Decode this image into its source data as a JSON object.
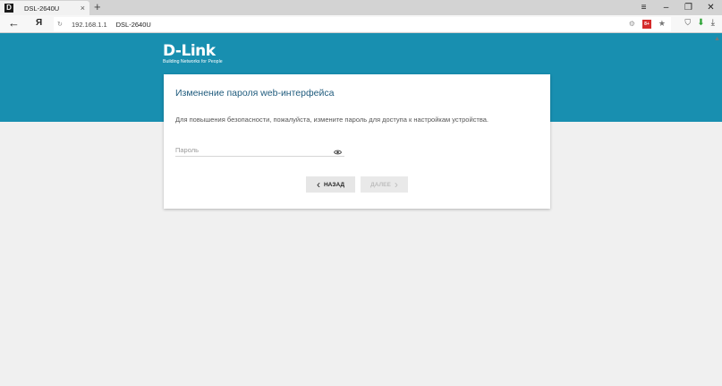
{
  "browser": {
    "tab": {
      "favicon": "D",
      "title": "DSL-2640U",
      "close_glyph": "×"
    },
    "new_tab_glyph": "+",
    "window_controls": [
      "≡",
      "–",
      "❐",
      "✕"
    ],
    "back_glyph": "←",
    "yandex_glyph": "Я",
    "reload_glyph": "↻",
    "url": "192.168.1.1",
    "page_title": "DSL-2640U",
    "badge_text": "8+",
    "star_glyph": "★",
    "shield_glyph": "⛉",
    "download_green_glyph": "⬇",
    "download_glyph": "⤓"
  },
  "logo": {
    "main": "D-Link",
    "tagline": "Building Networks for People"
  },
  "card": {
    "title": "Изменение пароля web-интерфейса",
    "description": "Для повышения безопасности, пожалуйста, измените пароль для доступа к настройкам устройства.",
    "password": {
      "placeholder": "Пароль",
      "value": ""
    },
    "back_label": "НАЗАД",
    "next_label": "ДАЛЕЕ"
  },
  "colors": {
    "header": "#188fb0",
    "title": "#1f5b7d",
    "background": "#f0f0f0"
  }
}
